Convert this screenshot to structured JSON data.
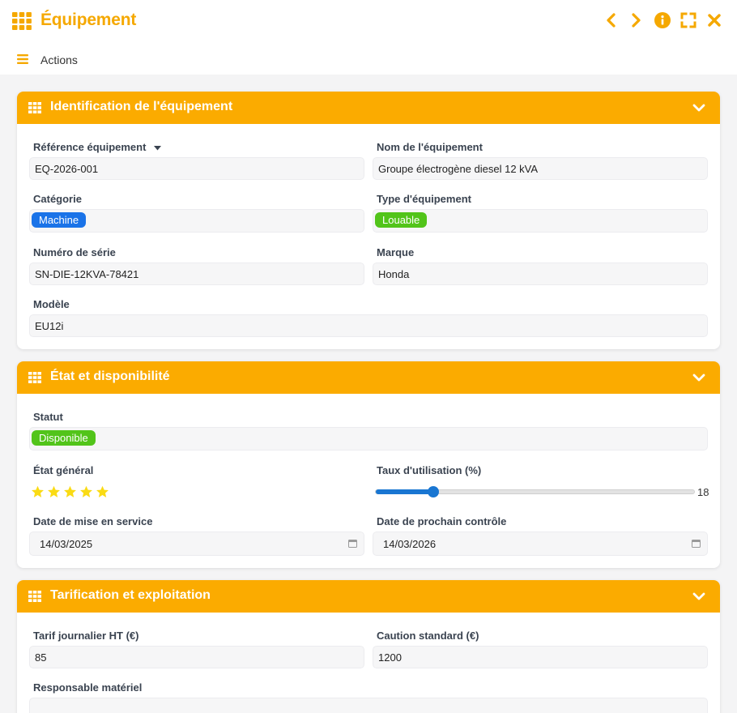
{
  "window": {
    "title": "Équipement",
    "accent": "#fbab00",
    "title_color": "#f5a800"
  },
  "toolbar": {
    "actions_label": "Actions"
  },
  "sections": {
    "identification": {
      "title": "Identification de l'équipement",
      "reference_label": "Référence équipement",
      "reference_value": "EQ-2026-001",
      "name_label": "Nom de l'équipement",
      "name_value": "Groupe électrogène diesel 12 kVA",
      "category_label": "Catégorie",
      "category_value": "Machine",
      "category_color": "#1a73e8",
      "type_label": "Type d'équipement",
      "type_value": "Louable",
      "type_color": "#52c41a",
      "serial_label": "Numéro de série",
      "serial_value": "SN-DIE-12KVA-78421",
      "brand_label": "Marque",
      "brand_value": "Honda",
      "model_label": "Modèle",
      "model_value": "EU12i"
    },
    "status": {
      "title": "État et disponibilité",
      "status_label": "Statut",
      "status_value": "Disponible",
      "status_color": "#52c41a",
      "condition_label": "État général",
      "condition_rating": 5,
      "condition_max": 5,
      "star_color": "#fadb14",
      "usage_label": "Taux d'utilisation (%)",
      "usage_value": "18",
      "slider_color": "#1976d2",
      "commission_label": "Date de mise en service",
      "commission_value": "14/03/2025",
      "next_check_label": "Date de prochain contrôle",
      "next_check_value": "14/03/2026"
    },
    "pricing": {
      "title": "Tarification et exploitation",
      "daily_rate_label": "Tarif journalier HT (€)",
      "daily_rate_value": "85",
      "deposit_label": "Caution standard (€)",
      "deposit_value": "1200",
      "manager_label": "Responsable matériel",
      "manager_value": ""
    }
  }
}
